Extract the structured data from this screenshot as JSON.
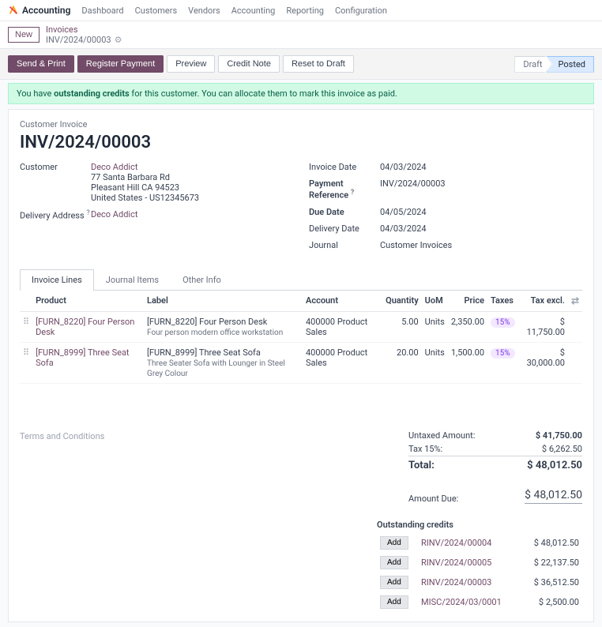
{
  "app_name": "Accounting",
  "nav": [
    "Dashboard",
    "Customers",
    "Vendors",
    "Accounting",
    "Reporting",
    "Configuration"
  ],
  "new_btn": "New",
  "breadcrumb_parent": "Invoices",
  "breadcrumb_current": "INV/2024/00003",
  "actions": {
    "send_print": "Send & Print",
    "register_payment": "Register Payment",
    "preview": "Preview",
    "credit_note": "Credit Note",
    "reset_draft": "Reset to Draft"
  },
  "status": {
    "draft": "Draft",
    "posted": "Posted"
  },
  "alert_pre": "You have ",
  "alert_bold": "outstanding credits",
  "alert_post": " for this customer. You can allocate them to mark this invoice as paid.",
  "sheet_title": "Customer Invoice",
  "doc_name": "INV/2024/00003",
  "left_fields": {
    "customer_label": "Customer",
    "customer_name": "Deco Addict",
    "addr1": "77 Santa Barbara Rd",
    "addr2": "Pleasant Hill CA 94523",
    "addr3": "United States - US12345673",
    "delivery_label": "Delivery Address",
    "delivery_val": "Deco Addict"
  },
  "right_fields": {
    "invoice_date_l": "Invoice Date",
    "invoice_date_v": "04/03/2024",
    "payment_ref_l": "Payment Reference",
    "payment_ref_v": "INV/2024/00003",
    "due_date_l": "Due Date",
    "due_date_v": "04/05/2024",
    "delivery_date_l": "Delivery Date",
    "delivery_date_v": "04/03/2024",
    "journal_l": "Journal",
    "journal_v": "Customer Invoices"
  },
  "tabs": {
    "invoice_lines": "Invoice Lines",
    "journal_items": "Journal Items",
    "other_info": "Other Info"
  },
  "cols": {
    "product": "Product",
    "label": "Label",
    "account": "Account",
    "quantity": "Quantity",
    "uom": "UoM",
    "price": "Price",
    "taxes": "Taxes",
    "tax_excl": "Tax excl."
  },
  "lines": [
    {
      "product": "[FURN_8220] Four Person Desk",
      "label": "[FURN_8220] Four Person Desk",
      "desc": "Four person modern office workstation",
      "account": "400000 Product Sales",
      "qty": "5.00",
      "uom": "Units",
      "price": "2,350.00",
      "tax": "15%",
      "subtotal": "$ 11,750.00"
    },
    {
      "product": "[FURN_8999] Three Seat Sofa",
      "label": "[FURN_8999] Three Seat Sofa",
      "desc": "Three Seater Sofa with Lounger in Steel Grey Colour",
      "account": "400000 Product Sales",
      "qty": "20.00",
      "uom": "Units",
      "price": "1,500.00",
      "tax": "15%",
      "subtotal": "$ 30,000.00"
    }
  ],
  "terms_placeholder": "Terms and Conditions",
  "totals": {
    "untaxed_l": "Untaxed Amount:",
    "untaxed_v": "$ 41,750.00",
    "tax_l": "Tax 15%:",
    "tax_v": "$ 6,262.50",
    "total_l": "Total:",
    "total_v": "$ 48,012.50"
  },
  "amount_due_l": "Amount Due:",
  "amount_due_v": "$ 48,012.50",
  "credits_title": "Outstanding credits",
  "add_label": "Add",
  "credits": [
    {
      "ref": "RINV/2024/00004",
      "amt": "$ 48,012.50"
    },
    {
      "ref": "RINV/2024/00005",
      "amt": "$ 22,137.50"
    },
    {
      "ref": "RINV/2024/00003",
      "amt": "$ 36,512.50"
    },
    {
      "ref": "MISC/2024/03/0001",
      "amt": "$ 2,500.00"
    }
  ]
}
